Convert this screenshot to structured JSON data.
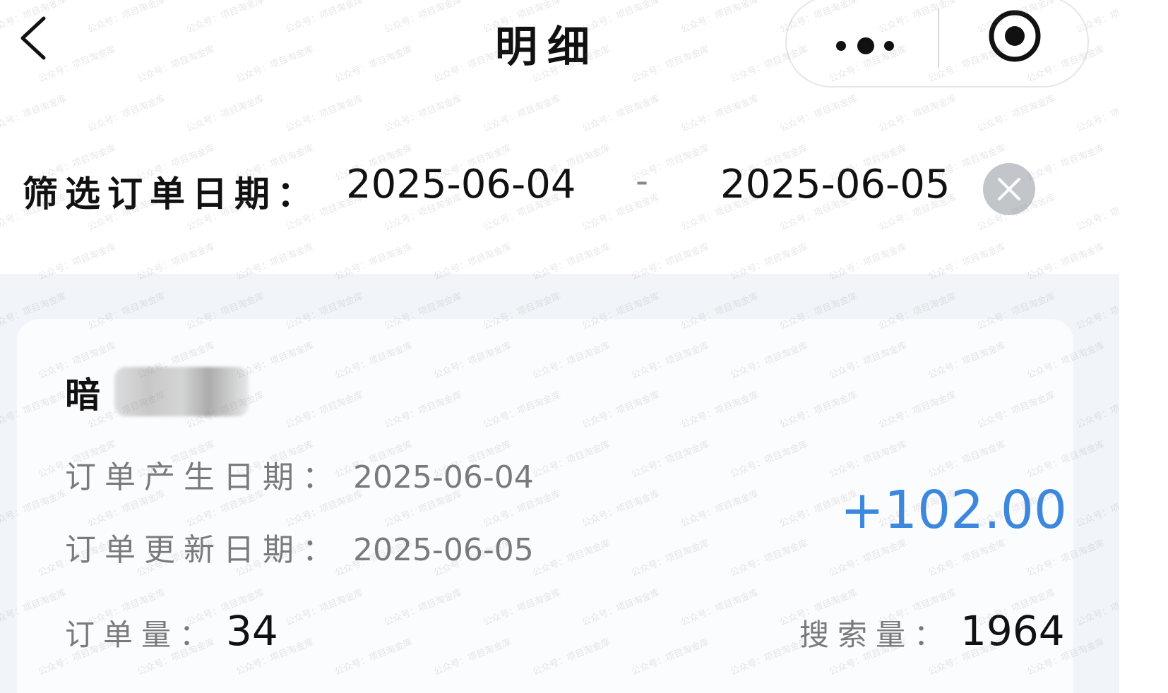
{
  "header": {
    "title": "明细"
  },
  "filter": {
    "label": "筛选订单日期：",
    "start_date": "2025-06-04",
    "separator": "-",
    "end_date": "2025-06-05"
  },
  "order": {
    "name_visible": "暗",
    "created_label": "订单产生日期：",
    "created_value": "2025-06-04",
    "updated_label": "订单更新日期：",
    "updated_value": "2025-06-05",
    "amount": "+102.00",
    "order_count_label": "订单量：",
    "order_count_value": "34",
    "search_count_label": "搜索量：",
    "search_count_value": "1964"
  },
  "watermark": {
    "text": "公众号：项目淘金库"
  },
  "icons": {
    "back": "chevron-left-icon",
    "more": "more-dots-icon",
    "close_mini": "target-circle-icon",
    "clear": "clear-x-icon"
  },
  "colors": {
    "amount": "#3d88df",
    "content_bg": "#f1f5fa",
    "clear_button": "#c2c6cb"
  }
}
